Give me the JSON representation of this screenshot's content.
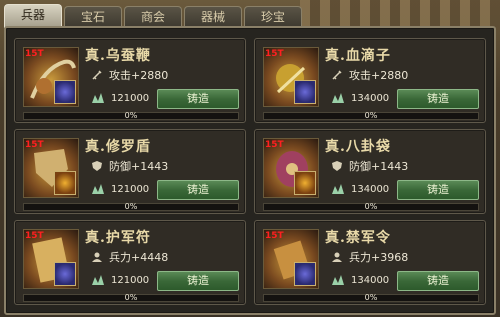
{
  "tabs": [
    {
      "label": "兵器",
      "active": true
    },
    {
      "label": "宝石",
      "active": false
    },
    {
      "label": "商会",
      "active": false
    },
    {
      "label": "器械",
      "active": false
    },
    {
      "label": "珍宝",
      "active": false
    }
  ],
  "forge_label": "铸造",
  "items": [
    {
      "name": "真.乌蚕鞭",
      "level": "15T",
      "stat_icon": "sword-icon",
      "stat": "攻击+2880",
      "cost": "121000",
      "progress_pct": 0,
      "progress_text": "0%",
      "gem_color": "#6a6ad8"
    },
    {
      "name": "真.血滴子",
      "level": "15T",
      "stat_icon": "sword-icon",
      "stat": "攻击+2880",
      "cost": "134000",
      "progress_pct": 0,
      "progress_text": "0%",
      "gem_color": "#6a6ad8"
    },
    {
      "name": "真.修罗盾",
      "level": "15T",
      "stat_icon": "shield-icon",
      "stat": "防御+1443",
      "cost": "121000",
      "progress_pct": 0,
      "progress_text": "0%",
      "gem_color": "#f0b030"
    },
    {
      "name": "真.八卦袋",
      "level": "15T",
      "stat_icon": "shield-icon",
      "stat": "防御+1443",
      "cost": "134000",
      "progress_pct": 0,
      "progress_text": "0%",
      "gem_color": "#f0b030"
    },
    {
      "name": "真.护军符",
      "level": "15T",
      "stat_icon": "soldier-icon",
      "stat": "兵力+4448",
      "cost": "121000",
      "progress_pct": 0,
      "progress_text": "0%",
      "gem_color": "#6a6ad8"
    },
    {
      "name": "真.禁军令",
      "level": "15T",
      "stat_icon": "soldier-icon",
      "stat": "兵力+3968",
      "cost": "134000",
      "progress_pct": 0,
      "progress_text": "0%",
      "gem_color": "#6a6ad8"
    }
  ]
}
